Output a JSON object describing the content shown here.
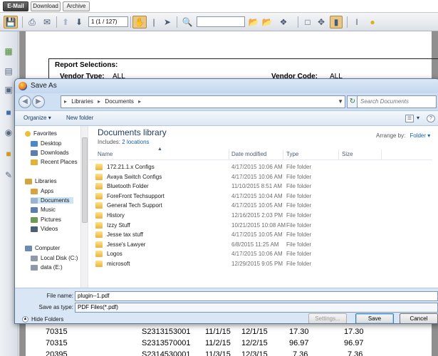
{
  "tabs": [
    "E-Mail",
    "Download",
    "Archive"
  ],
  "toolbar": {
    "page_field": "1 (1 / 127)"
  },
  "report": {
    "selections_label": "Report Selections:",
    "vendor_type_label": "Vendor Type:",
    "vendor_type_value": "ALL",
    "vendor_code_label": "Vendor Code:",
    "vendor_code_value": "ALL",
    "rows": [
      [
        "70315",
        "S2313153001",
        "11/1/15",
        "12/1/15",
        "17.30",
        "17.30"
      ],
      [
        "70315",
        "S2313570001",
        "11/2/15",
        "12/2/15",
        "96.97",
        "96.97"
      ],
      [
        "20395",
        "S2314530001",
        "11/3/15",
        "12/3/15",
        "7.36",
        "7.36"
      ]
    ]
  },
  "dialog": {
    "title": "Save As",
    "breadcrumb": [
      "Libraries",
      "Documents"
    ],
    "search_placeholder": "Search Documents",
    "organize_label": "Organize",
    "new_folder_label": "New folder",
    "library_title": "Documents library",
    "includes_label": "Includes:",
    "includes_link": "2 locations",
    "arrange_label": "Arrange by:",
    "arrange_value": "Folder",
    "columns": {
      "name": "Name",
      "date": "Date modified",
      "type": "Type",
      "size": "Size"
    },
    "nav": {
      "favorites": {
        "label": "Favorites",
        "items": [
          "Desktop",
          "Downloads",
          "Recent Places"
        ]
      },
      "libraries": {
        "label": "Libraries",
        "items": [
          "Apps",
          "Documents",
          "Music",
          "Pictures",
          "Videos"
        ]
      },
      "computer": {
        "label": "Computer",
        "items": [
          "Local Disk (C:)",
          "data (E:)"
        ]
      }
    },
    "files": [
      {
        "name": "172.21.1.x Configs",
        "date": "4/17/2015 10:06 AM",
        "type": "File folder"
      },
      {
        "name": "Avaya Switch Configs",
        "date": "4/17/2015 10:06 AM",
        "type": "File folder"
      },
      {
        "name": "Bluetooth Folder",
        "date": "11/10/2015 8:51 AM",
        "type": "File folder"
      },
      {
        "name": "ForeFront Techsupport",
        "date": "4/17/2015 10:04 AM",
        "type": "File folder"
      },
      {
        "name": "General Tech Support",
        "date": "4/17/2015 10:05 AM",
        "type": "File folder"
      },
      {
        "name": "History",
        "date": "12/16/2015 2:03 PM",
        "type": "File folder"
      },
      {
        "name": "Izzy Stuff",
        "date": "10/21/2015 10:08 AM",
        "type": "File folder"
      },
      {
        "name": "Jesse tax stuff",
        "date": "4/17/2015 10:05 AM",
        "type": "File folder"
      },
      {
        "name": "Jesse's Lawyer",
        "date": "6/8/2015 11:25 AM",
        "type": "File folder"
      },
      {
        "name": "Logos",
        "date": "4/17/2015 10:06 AM",
        "type": "File folder"
      },
      {
        "name": "microsoft",
        "date": "12/29/2015 9:05 PM",
        "type": "File folder"
      }
    ],
    "file_name_label": "File name:",
    "file_name_value": "plugin--1.pdf",
    "save_type_label": "Save as type:",
    "save_type_value": "PDF Files(*.pdf)",
    "hide_folders_label": "Hide Folders",
    "settings_label": "Settings...",
    "save_label": "Save",
    "cancel_label": "Cancel"
  }
}
